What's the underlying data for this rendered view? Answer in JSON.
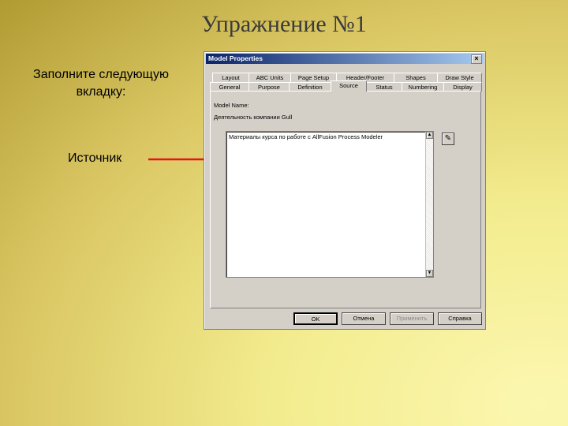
{
  "slide": {
    "title": "Упражнение №1",
    "instruction": "Заполните следующую вкладку:",
    "source_label": "Источник"
  },
  "dialog": {
    "title": "Model Properties",
    "close_glyph": "×",
    "tabs_row1": [
      "Layout",
      "ABC Units",
      "Page Setup",
      "Header/Footer",
      "Shapes",
      "Draw Style"
    ],
    "tabs_row2": [
      "General",
      "Purpose",
      "Definition",
      "Source",
      "Status",
      "Numbering",
      "Display"
    ],
    "active_tab": "Source",
    "model_name_label": "Model Name:",
    "model_name_value": "Деятельность компании Gull",
    "source_text": "Материалы курса по работе с AllFusion Process Modeler",
    "buttons": {
      "ok": "OK",
      "cancel": "Отмена",
      "apply": "Применить",
      "help": "Справка"
    }
  },
  "colors": {
    "titlebar_start": "#0a246a",
    "titlebar_end": "#a6caf0",
    "dialog_bg": "#d4d0c8",
    "arrow": "#e8141c"
  }
}
